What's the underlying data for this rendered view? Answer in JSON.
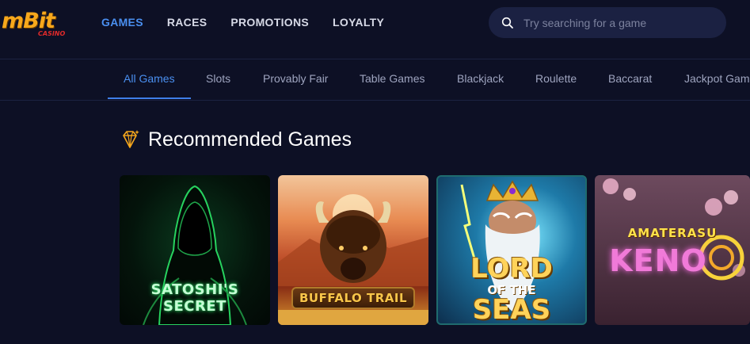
{
  "header": {
    "logo": {
      "text": "mBit",
      "sub": "CASINO"
    },
    "nav": [
      {
        "label": "GAMES",
        "active": true
      },
      {
        "label": "RACES",
        "active": false
      },
      {
        "label": "PROMOTIONS",
        "active": false
      },
      {
        "label": "LOYALTY",
        "active": false
      }
    ],
    "search": {
      "placeholder": "Try searching for a game",
      "icon": "search-icon"
    }
  },
  "categories": [
    {
      "label": "All Games",
      "active": true
    },
    {
      "label": "Slots",
      "active": false
    },
    {
      "label": "Provably Fair",
      "active": false
    },
    {
      "label": "Table Games",
      "active": false
    },
    {
      "label": "Blackjack",
      "active": false
    },
    {
      "label": "Roulette",
      "active": false
    },
    {
      "label": "Baccarat",
      "active": false
    },
    {
      "label": "Jackpot Game",
      "active": false
    }
  ],
  "section": {
    "title": "Recommended Games",
    "icon": "diamond-icon"
  },
  "games": [
    {
      "title": "SATOSHI'S SECRET"
    },
    {
      "title": "BUFFALO TRAIL"
    },
    {
      "title_lines": [
        "LORD",
        "OF THE",
        "SEAS"
      ]
    },
    {
      "title_lines": [
        "AMATERASU",
        "KENO"
      ]
    }
  ],
  "colors": {
    "background": "#0d1025",
    "accent": "#4a8ff0",
    "logo": "#f7a81c",
    "search_bg": "#1b2142"
  }
}
